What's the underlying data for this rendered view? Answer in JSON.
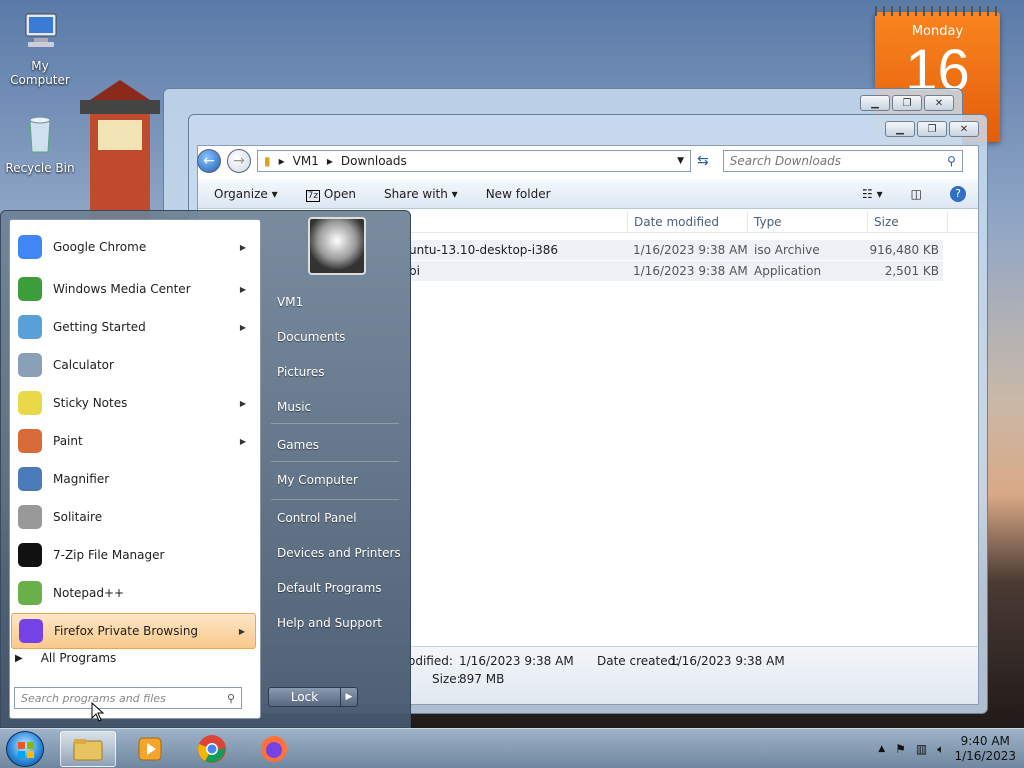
{
  "desktop": {
    "icons": [
      {
        "label": "My Computer"
      },
      {
        "label": "Recycle Bin"
      }
    ],
    "calendar": {
      "day": "Monday",
      "date": "16"
    }
  },
  "explorer": {
    "breadcrumb": [
      "VM1",
      "Downloads"
    ],
    "search_placeholder": "Search Downloads",
    "toolbar": {
      "organize": "Organize",
      "open": "Open",
      "share_with": "Share with",
      "new_folder": "New folder"
    },
    "columns": {
      "date": "Date modified",
      "type": "Type",
      "size": "Size"
    },
    "files": [
      {
        "name": "untu-13.10-desktop-i386",
        "date": "1/16/2023 9:38 AM",
        "type": "iso Archive",
        "size": "916,480 KB"
      },
      {
        "name": "bi",
        "date": "1/16/2023 9:38 AM",
        "type": "Application",
        "size": "2,501 KB"
      }
    ],
    "status": {
      "modified_label": "odified:",
      "modified_value": "1/16/2023 9:38 AM",
      "created_label": "Date created:",
      "created_value": "1/16/2023 9:38 AM",
      "size_label": "Size:",
      "size_value": "897 MB"
    }
  },
  "start_menu": {
    "programs": [
      {
        "label": "Google Chrome",
        "submenu": true,
        "icon": "chrome-icon"
      },
      {
        "label": "Windows Media Center",
        "submenu": true,
        "icon": "media-center-icon"
      },
      {
        "label": "Getting Started",
        "submenu": true,
        "icon": "getting-started-icon"
      },
      {
        "label": "Calculator",
        "submenu": false,
        "icon": "calculator-icon"
      },
      {
        "label": "Sticky Notes",
        "submenu": true,
        "icon": "sticky-notes-icon"
      },
      {
        "label": "Paint",
        "submenu": true,
        "icon": "paint-icon"
      },
      {
        "label": "Magnifier",
        "submenu": false,
        "icon": "magnifier-icon"
      },
      {
        "label": "Solitaire",
        "submenu": false,
        "icon": "solitaire-icon"
      },
      {
        "label": "7-Zip File Manager",
        "submenu": false,
        "icon": "7zip-icon"
      },
      {
        "label": "Notepad++",
        "submenu": false,
        "icon": "notepadpp-icon"
      },
      {
        "label": "Firefox Private Browsing",
        "submenu": true,
        "icon": "firefox-private-icon"
      }
    ],
    "all_programs": "All Programs",
    "search_placeholder": "Search programs and files",
    "right_links": [
      "VM1",
      "Documents",
      "Pictures",
      "Music",
      "Games",
      "My Computer",
      "Control Panel",
      "Devices and Printers",
      "Default Programs",
      "Help and Support"
    ],
    "lock_label": "Lock"
  },
  "taskbar": {
    "time": "9:40 AM",
    "date": "1/16/2023"
  }
}
